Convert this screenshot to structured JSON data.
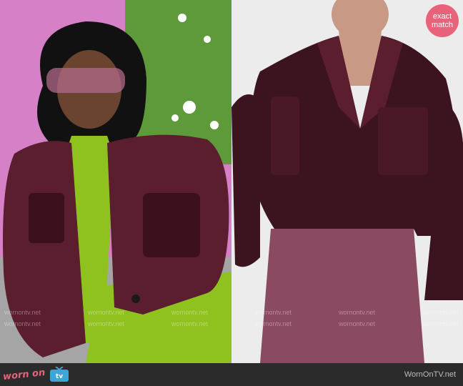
{
  "badge": {
    "line1": "exact",
    "line2": "match",
    "color": "#e8627a"
  },
  "watermark": {
    "text": "wornontv.net"
  },
  "footer": {
    "logo_word": "worn on",
    "logo_tv_text": "tv",
    "site_name": "WornOnTV.net",
    "bg_color": "#2b2b2b",
    "brand_color": "#e8627a"
  },
  "photos": {
    "left": {
      "label": ""
    },
    "right": {
      "label": ""
    }
  },
  "colors": {
    "jacket": "#5a1e2e",
    "jacket_dark": "#3b0f1c",
    "top": "#8fc21f",
    "skirt": "#8a4a62",
    "left_bg": "#d680c8",
    "garden": "#5e9a3a"
  }
}
